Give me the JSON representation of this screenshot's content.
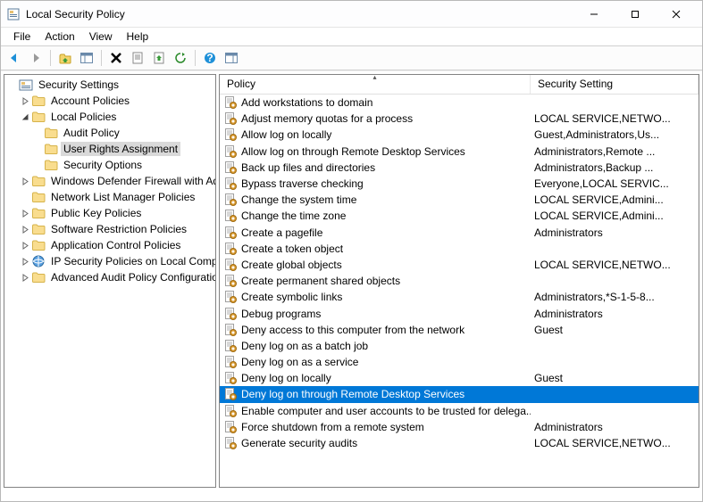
{
  "window": {
    "title": "Local Security Policy"
  },
  "menubar": [
    "File",
    "Action",
    "View",
    "Help"
  ],
  "tree": [
    {
      "level": 0,
      "tw": "",
      "icon": "root",
      "label": "Security Settings",
      "sel": false
    },
    {
      "level": 1,
      "tw": ">",
      "icon": "folder",
      "label": "Account Policies",
      "sel": false
    },
    {
      "level": 1,
      "tw": "v",
      "icon": "folder",
      "label": "Local Policies",
      "sel": false
    },
    {
      "level": 2,
      "tw": "",
      "icon": "folder",
      "label": "Audit Policy",
      "sel": false
    },
    {
      "level": 2,
      "tw": "",
      "icon": "folder",
      "label": "User Rights Assignment",
      "sel": true
    },
    {
      "level": 2,
      "tw": "",
      "icon": "folder",
      "label": "Security Options",
      "sel": false
    },
    {
      "level": 1,
      "tw": ">",
      "icon": "folder",
      "label": "Windows Defender Firewall with Adva",
      "sel": false
    },
    {
      "level": 1,
      "tw": "",
      "icon": "folder",
      "label": "Network List Manager Policies",
      "sel": false
    },
    {
      "level": 1,
      "tw": ">",
      "icon": "folder",
      "label": "Public Key Policies",
      "sel": false
    },
    {
      "level": 1,
      "tw": ">",
      "icon": "folder",
      "label": "Software Restriction Policies",
      "sel": false
    },
    {
      "level": 1,
      "tw": ">",
      "icon": "folder",
      "label": "Application Control Policies",
      "sel": false
    },
    {
      "level": 1,
      "tw": ">",
      "icon": "ipsec",
      "label": "IP Security Policies on Local Compute",
      "sel": false
    },
    {
      "level": 1,
      "tw": ">",
      "icon": "folder",
      "label": "Advanced Audit Policy Configuration",
      "sel": false
    }
  ],
  "columns": {
    "policy": "Policy",
    "setting": "Security Setting"
  },
  "policies": [
    {
      "name": "Add workstations to domain",
      "setting": ""
    },
    {
      "name": "Adjust memory quotas for a process",
      "setting": "LOCAL SERVICE,NETWO..."
    },
    {
      "name": "Allow log on locally",
      "setting": "Guest,Administrators,Us..."
    },
    {
      "name": "Allow log on through Remote Desktop Services",
      "setting": "Administrators,Remote ..."
    },
    {
      "name": "Back up files and directories",
      "setting": "Administrators,Backup ..."
    },
    {
      "name": "Bypass traverse checking",
      "setting": "Everyone,LOCAL SERVIC..."
    },
    {
      "name": "Change the system time",
      "setting": "LOCAL SERVICE,Admini..."
    },
    {
      "name": "Change the time zone",
      "setting": "LOCAL SERVICE,Admini..."
    },
    {
      "name": "Create a pagefile",
      "setting": "Administrators"
    },
    {
      "name": "Create a token object",
      "setting": ""
    },
    {
      "name": "Create global objects",
      "setting": "LOCAL SERVICE,NETWO..."
    },
    {
      "name": "Create permanent shared objects",
      "setting": ""
    },
    {
      "name": "Create symbolic links",
      "setting": "Administrators,*S-1-5-8..."
    },
    {
      "name": "Debug programs",
      "setting": "Administrators"
    },
    {
      "name": "Deny access to this computer from the network",
      "setting": "Guest"
    },
    {
      "name": "Deny log on as a batch job",
      "setting": ""
    },
    {
      "name": "Deny log on as a service",
      "setting": ""
    },
    {
      "name": "Deny log on locally",
      "setting": "Guest"
    },
    {
      "name": "Deny log on through Remote Desktop Services",
      "setting": "",
      "sel": true
    },
    {
      "name": "Enable computer and user accounts to be trusted for delega...",
      "setting": ""
    },
    {
      "name": "Force shutdown from a remote system",
      "setting": "Administrators"
    },
    {
      "name": "Generate security audits",
      "setting": "LOCAL SERVICE,NETWO..."
    }
  ]
}
